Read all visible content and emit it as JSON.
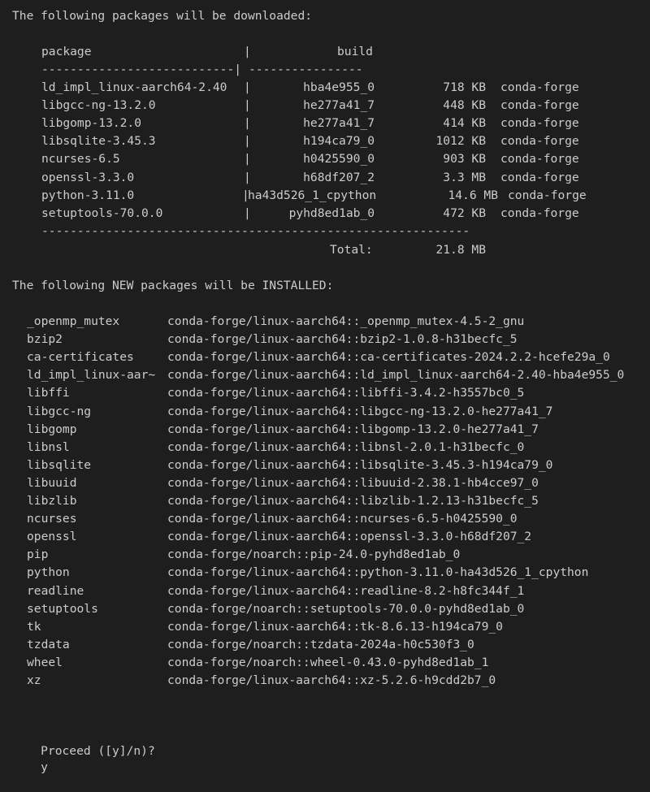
{
  "download": {
    "heading": "The following packages will be downloaded:",
    "columns": {
      "package": "package",
      "build": "build"
    },
    "separator_left": "---------------------------|",
    "separator_right": "----------------",
    "rows": [
      {
        "name": "ld_impl_linux-aarch64-2.40",
        "build": "hba4e955_0",
        "size": "718 KB",
        "channel": "conda-forge"
      },
      {
        "name": "libgcc-ng-13.2.0",
        "build": "he277a41_7",
        "size": "448 KB",
        "channel": "conda-forge"
      },
      {
        "name": "libgomp-13.2.0",
        "build": "he277a41_7",
        "size": "414 KB",
        "channel": "conda-forge"
      },
      {
        "name": "libsqlite-3.45.3",
        "build": "h194ca79_0",
        "size": "1012 KB",
        "channel": "conda-forge"
      },
      {
        "name": "ncurses-6.5",
        "build": "h0425590_0",
        "size": "903 KB",
        "channel": "conda-forge"
      },
      {
        "name": "openssl-3.3.0",
        "build": "h68df207_2",
        "size": "3.3 MB",
        "channel": "conda-forge"
      },
      {
        "name": "python-3.11.0",
        "build": "ha43d526_1_cpython",
        "size": "14.6 MB",
        "channel": "conda-forge"
      },
      {
        "name": "setuptools-70.0.0",
        "build": "pyhd8ed1ab_0",
        "size": "472 KB",
        "channel": "conda-forge"
      }
    ],
    "footer_rule": "------------------------------------------------------------",
    "total_label": "Total:",
    "total_value": "21.8 MB"
  },
  "install": {
    "heading": "The following NEW packages will be INSTALLED:",
    "rows": [
      {
        "name": "_openmp_mutex",
        "spec": "conda-forge/linux-aarch64::_openmp_mutex-4.5-2_gnu"
      },
      {
        "name": "bzip2",
        "spec": "conda-forge/linux-aarch64::bzip2-1.0.8-h31becfc_5"
      },
      {
        "name": "ca-certificates",
        "spec": "conda-forge/linux-aarch64::ca-certificates-2024.2.2-hcefe29a_0"
      },
      {
        "name": "ld_impl_linux-aar~",
        "spec": "conda-forge/linux-aarch64::ld_impl_linux-aarch64-2.40-hba4e955_0"
      },
      {
        "name": "libffi",
        "spec": "conda-forge/linux-aarch64::libffi-3.4.2-h3557bc0_5"
      },
      {
        "name": "libgcc-ng",
        "spec": "conda-forge/linux-aarch64::libgcc-ng-13.2.0-he277a41_7"
      },
      {
        "name": "libgomp",
        "spec": "conda-forge/linux-aarch64::libgomp-13.2.0-he277a41_7"
      },
      {
        "name": "libnsl",
        "spec": "conda-forge/linux-aarch64::libnsl-2.0.1-h31becfc_0"
      },
      {
        "name": "libsqlite",
        "spec": "conda-forge/linux-aarch64::libsqlite-3.45.3-h194ca79_0"
      },
      {
        "name": "libuuid",
        "spec": "conda-forge/linux-aarch64::libuuid-2.38.1-hb4cce97_0"
      },
      {
        "name": "libzlib",
        "spec": "conda-forge/linux-aarch64::libzlib-1.2.13-h31becfc_5"
      },
      {
        "name": "ncurses",
        "spec": "conda-forge/linux-aarch64::ncurses-6.5-h0425590_0"
      },
      {
        "name": "openssl",
        "spec": "conda-forge/linux-aarch64::openssl-3.3.0-h68df207_2"
      },
      {
        "name": "pip",
        "spec": "conda-forge/noarch::pip-24.0-pyhd8ed1ab_0"
      },
      {
        "name": "python",
        "spec": "conda-forge/linux-aarch64::python-3.11.0-ha43d526_1_cpython"
      },
      {
        "name": "readline",
        "spec": "conda-forge/linux-aarch64::readline-8.2-h8fc344f_1"
      },
      {
        "name": "setuptools",
        "spec": "conda-forge/noarch::setuptools-70.0.0-pyhd8ed1ab_0"
      },
      {
        "name": "tk",
        "spec": "conda-forge/linux-aarch64::tk-8.6.13-h194ca79_0"
      },
      {
        "name": "tzdata",
        "spec": "conda-forge/noarch::tzdata-2024a-h0c530f3_0"
      },
      {
        "name": "wheel",
        "spec": "conda-forge/noarch::wheel-0.43.0-pyhd8ed1ab_1"
      },
      {
        "name": "xz",
        "spec": "conda-forge/linux-aarch64::xz-5.2.6-h9cdd2b7_0"
      }
    ]
  },
  "prompt": {
    "text": "Proceed ([y]/n)?",
    "input": "y"
  },
  "theme": {
    "background": "#1e1e1e",
    "foreground": "#cccccc"
  }
}
